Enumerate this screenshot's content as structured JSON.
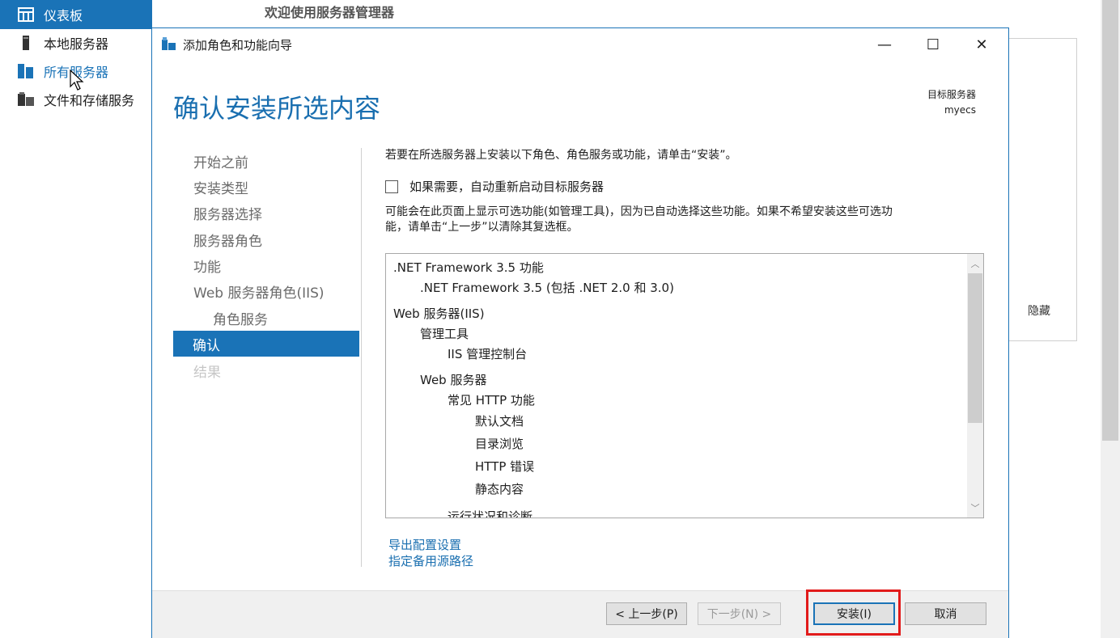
{
  "sidebar": {
    "items": [
      {
        "label": "仪表板",
        "icon": "dashboard-icon"
      },
      {
        "label": "本地服务器",
        "icon": "local-server-icon"
      },
      {
        "label": "所有服务器",
        "icon": "all-servers-icon"
      },
      {
        "label": "文件和存储服务",
        "icon": "file-storage-icon"
      }
    ]
  },
  "background": {
    "welcome_title": "欢迎使用服务器管理器",
    "hide_label": "隐藏"
  },
  "dialog": {
    "title": "添加角色和功能向导",
    "heading": "确认安装所选内容",
    "target_label": "目标服务器",
    "target_name": "myecs",
    "nav": [
      {
        "label": "开始之前",
        "state": "normal"
      },
      {
        "label": "安装类型",
        "state": "normal"
      },
      {
        "label": "服务器选择",
        "state": "normal"
      },
      {
        "label": "服务器角色",
        "state": "normal"
      },
      {
        "label": "功能",
        "state": "normal"
      },
      {
        "label": "Web 服务器角色(IIS)",
        "state": "normal"
      },
      {
        "label": "角色服务",
        "state": "sub"
      },
      {
        "label": "确认",
        "state": "active"
      },
      {
        "label": "结果",
        "state": "disabled"
      }
    ],
    "intro": "若要在所选服务器上安装以下角色、角色服务或功能，请单击“安装”。",
    "restart_checkbox_label": "如果需要，自动重新启动目标服务器",
    "restart_checked": false,
    "note_line1": "可能会在此页面上显示可选功能(如管理工具)，因为已自动选择这些功能。如果不希望安装这些可选功",
    "note_line2": "能，请单击“上一步”以清除其复选框。",
    "items": [
      ".NET Framework 3.5 功能",
      ".NET Framework 3.5 (包括 .NET 2.0 和 3.0)",
      "Web 服务器(IIS)",
      "管理工具",
      "IIS 管理控制台",
      "Web 服务器",
      "常见 HTTP 功能",
      "默认文档",
      "目录浏览",
      "HTTP 错误",
      "静态内容",
      "运行状况和诊断"
    ],
    "links": {
      "export": "导出配置设置",
      "alt_source": "指定备用源路径"
    },
    "buttons": {
      "prev": "< 上一步(P)",
      "next": "下一步(N) >",
      "install": "安装(I)",
      "cancel": "取消"
    },
    "window_controls": {
      "minimize": "—",
      "maximize": "☐",
      "close": "✕"
    }
  },
  "colors": {
    "accent": "#1a73b7",
    "highlight": "#e21b1b"
  }
}
